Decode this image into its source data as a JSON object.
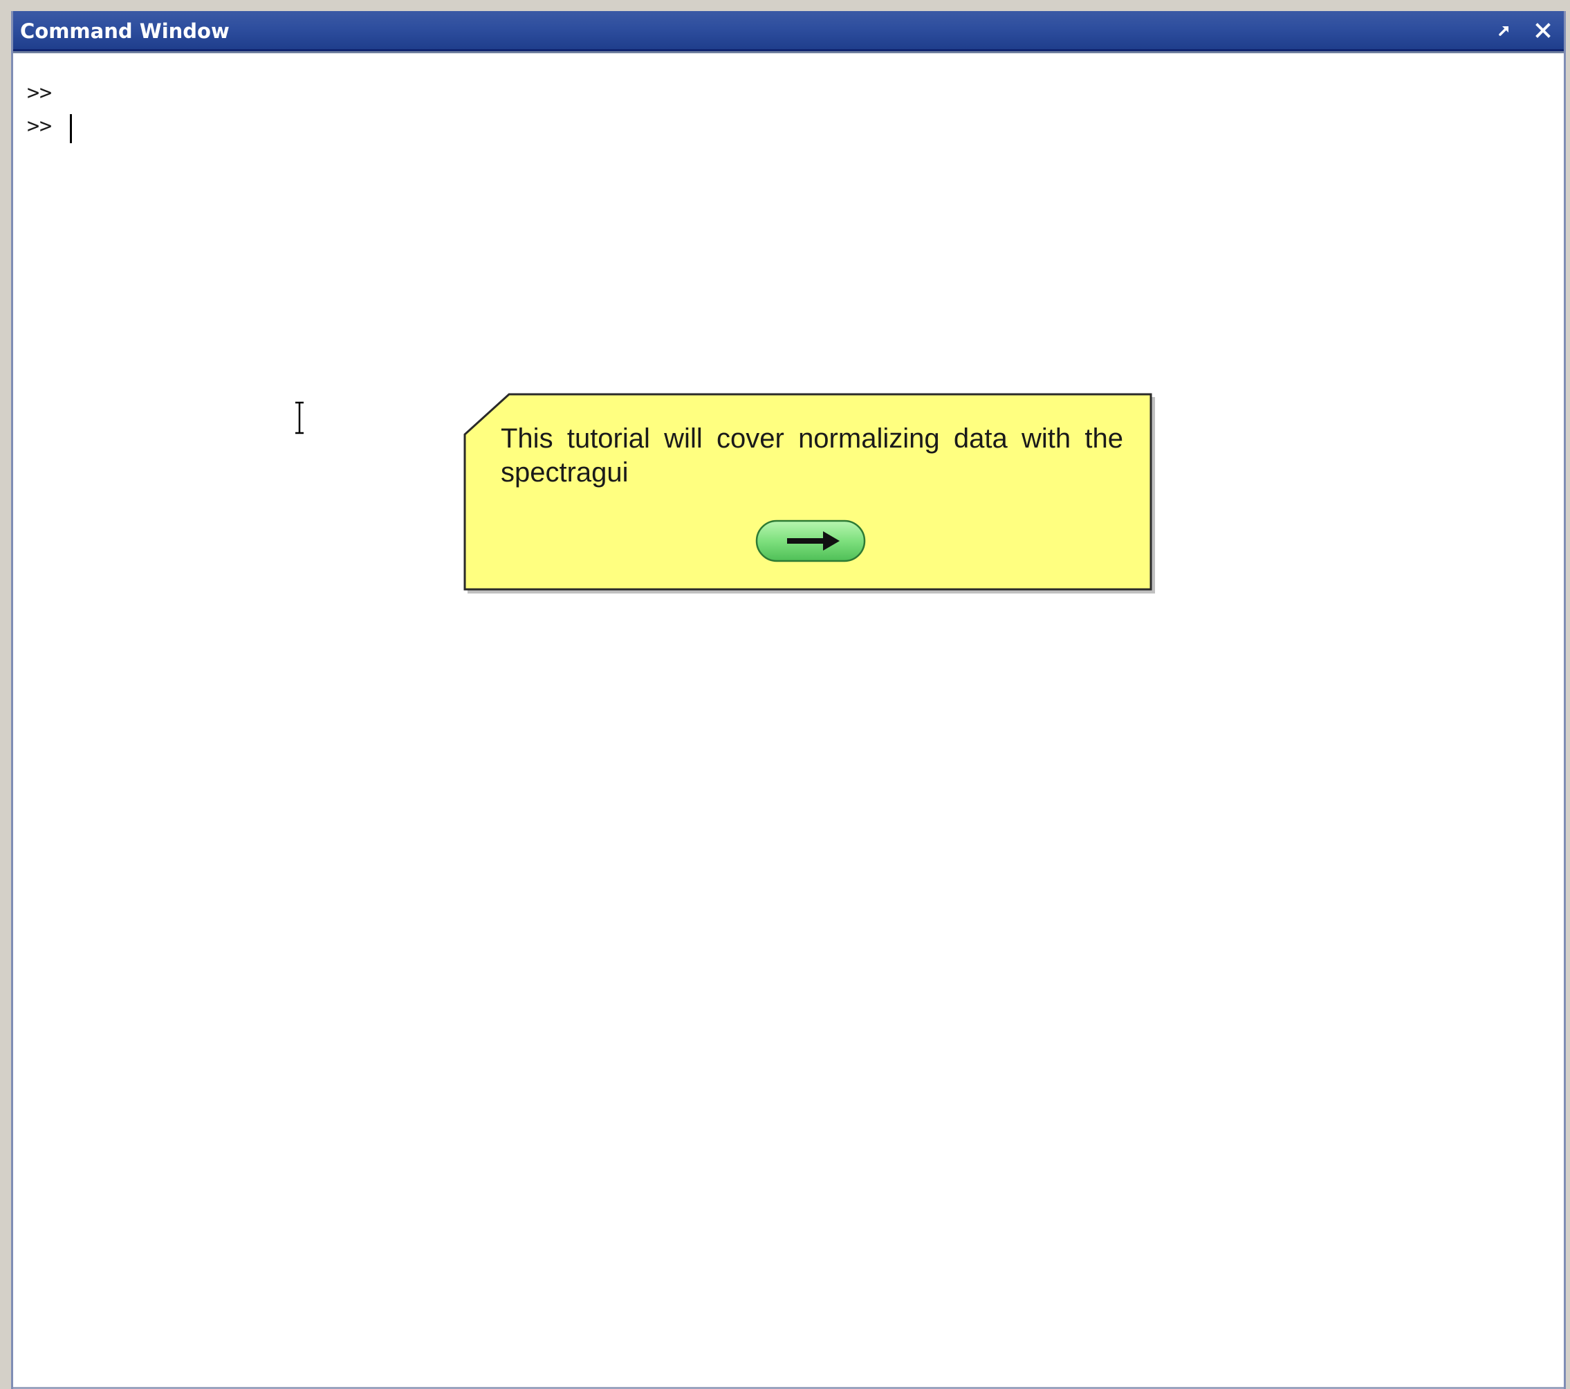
{
  "window": {
    "title": "Command Window",
    "undock_icon": "undock-arrow-icon",
    "close_icon": "close-icon"
  },
  "console": {
    "lines": [
      ">>",
      ">> "
    ]
  },
  "tutorial": {
    "message": "This tutorial will cover normalizing data with the spectragui",
    "next_icon": "right-arrow-icon",
    "colors": {
      "note_fill": "#ffff80",
      "button_fill": "#7ee07e"
    }
  },
  "colors": {
    "titlebar": "#2e4e9e",
    "background": "#ffffff"
  }
}
